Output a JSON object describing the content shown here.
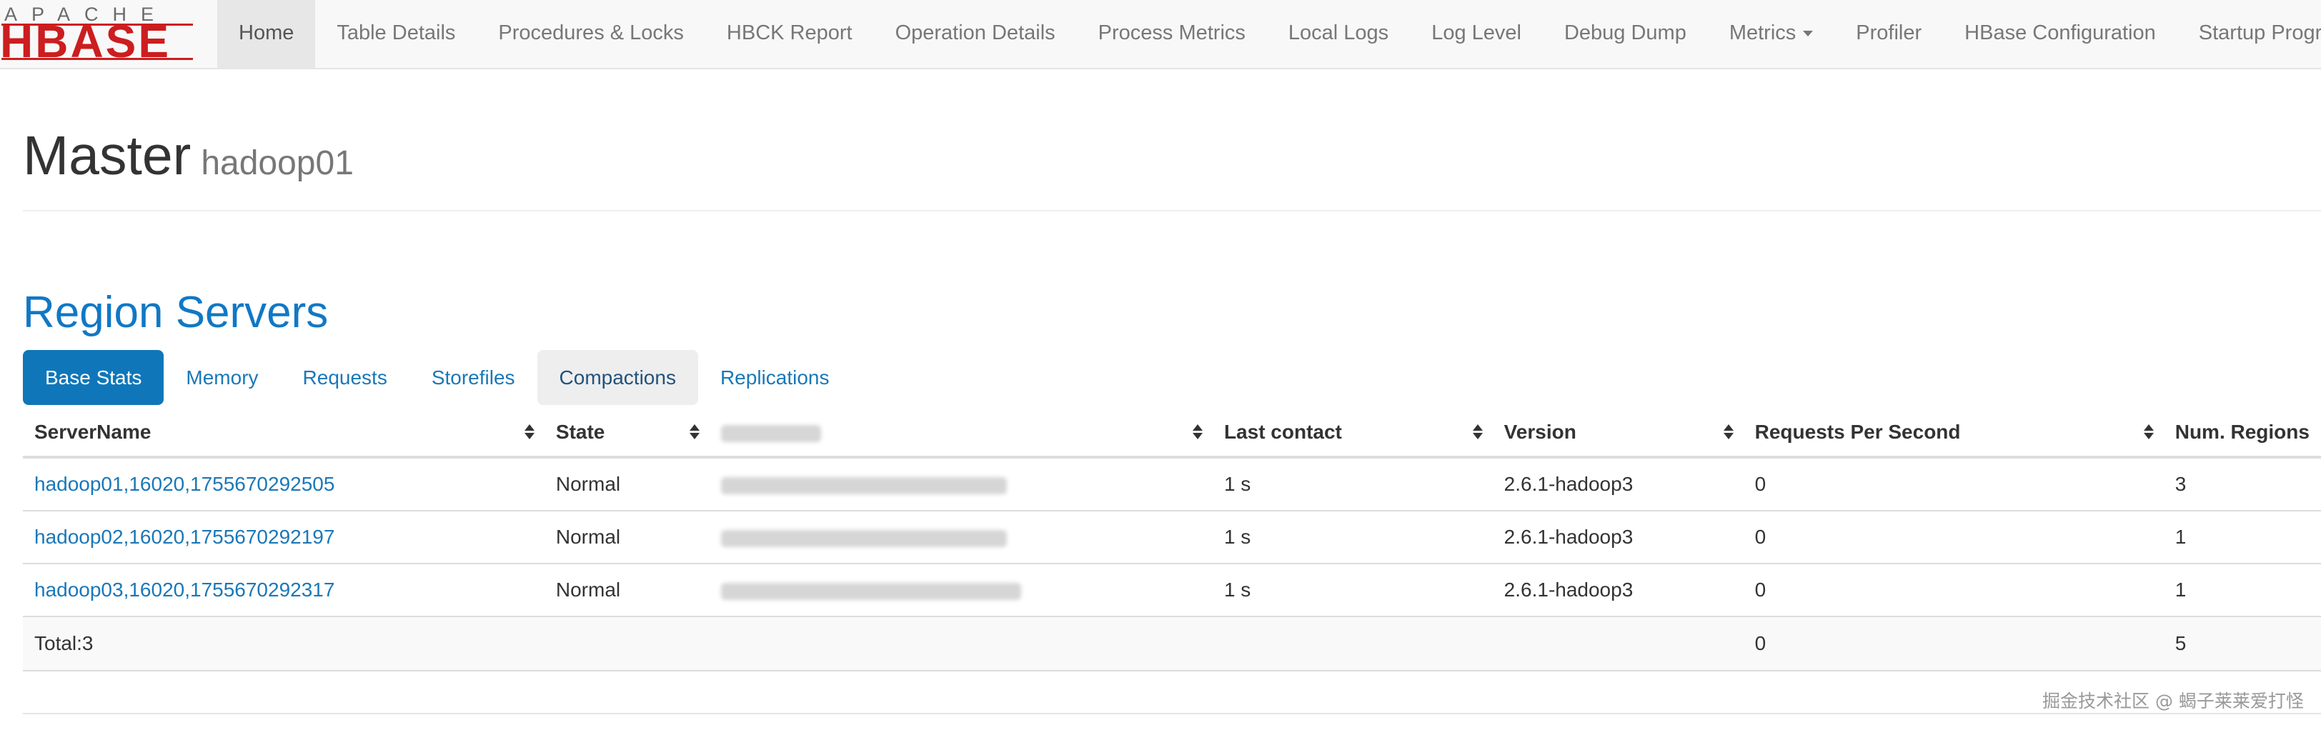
{
  "brand": {
    "top": "APACHE",
    "main": "HBASE"
  },
  "nav": {
    "items": [
      {
        "label": "Home",
        "active": true
      },
      {
        "label": "Table Details"
      },
      {
        "label": "Procedures & Locks"
      },
      {
        "label": "HBCK Report"
      },
      {
        "label": "Operation Details"
      },
      {
        "label": "Process Metrics"
      },
      {
        "label": "Local Logs"
      },
      {
        "label": "Log Level"
      },
      {
        "label": "Debug Dump"
      },
      {
        "label": "Metrics",
        "dropdown": true
      },
      {
        "label": "Profiler"
      },
      {
        "label": "HBase Configuration"
      },
      {
        "label": "Startup Progress"
      }
    ]
  },
  "header": {
    "title": "Master",
    "host": "hadoop01"
  },
  "region_servers": {
    "title": "Region Servers",
    "tabs": [
      "Base Stats",
      "Memory",
      "Requests",
      "Storefiles",
      "Compactions",
      "Replications"
    ],
    "columns": [
      "ServerName",
      "State",
      "",
      "Last contact",
      "Version",
      "Requests Per Second",
      "Num. Regions"
    ],
    "rows": [
      {
        "server": "hadoop01,16020,1755670292505",
        "state": "Normal",
        "last_contact": "1 s",
        "version": "2.6.1-hadoop3",
        "rps": "0",
        "regions": "3"
      },
      {
        "server": "hadoop02,16020,1755670292197",
        "state": "Normal",
        "last_contact": "1 s",
        "version": "2.6.1-hadoop3",
        "rps": "0",
        "regions": "1"
      },
      {
        "server": "hadoop03,16020,1755670292317",
        "state": "Normal",
        "last_contact": "1 s",
        "version": "2.6.1-hadoop3",
        "rps": "0",
        "regions": "1"
      }
    ],
    "total": {
      "label": "Total:3",
      "rps": "0",
      "regions": "5"
    }
  },
  "watermark": "掘金技术社区 @ 蝎子莱莱爱打怪",
  "colors": {
    "accent": "#0f77b9",
    "brand_red": "#cc1d1f",
    "link": "#1a78b8"
  }
}
